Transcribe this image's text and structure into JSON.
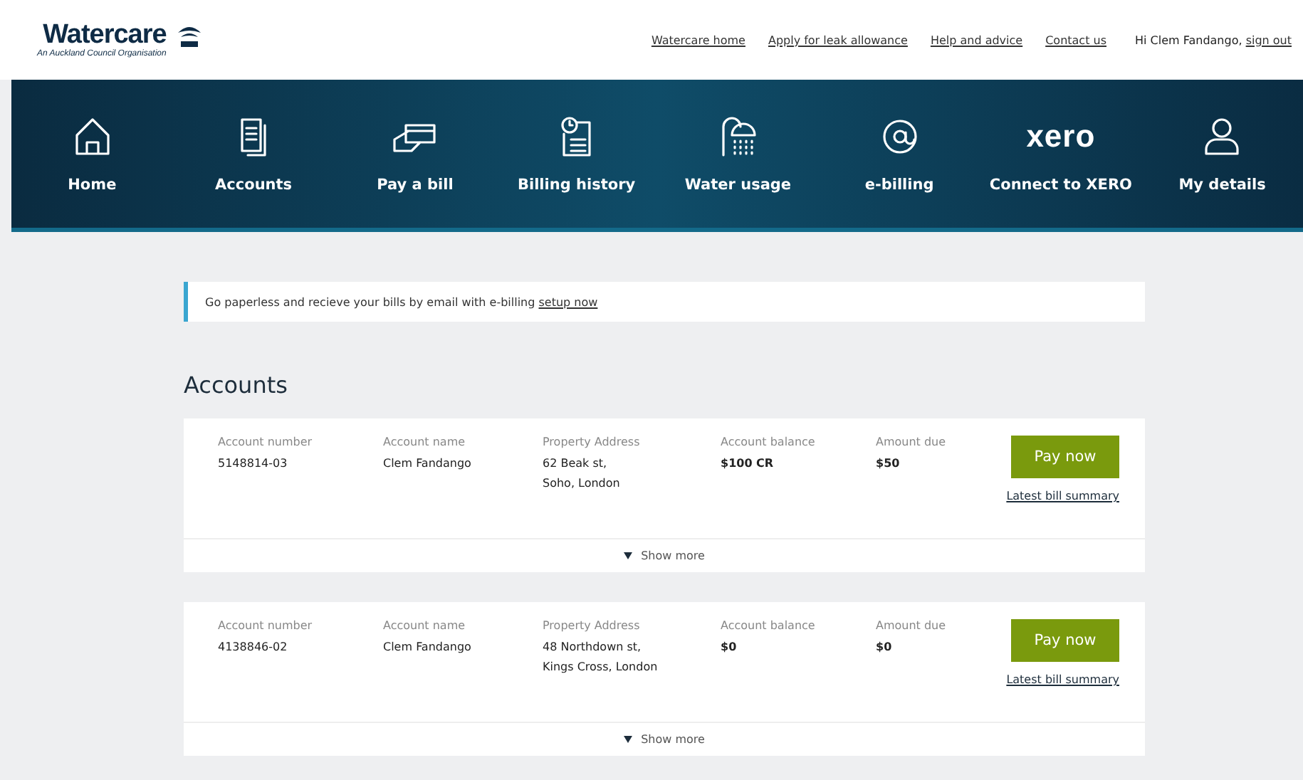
{
  "brand": {
    "name": "Watercare",
    "tagline": "An Auckland Council Organisation"
  },
  "top_links": [
    {
      "label": "Watercare home"
    },
    {
      "label": "Apply for leak allowance"
    },
    {
      "label": "Help and advice"
    },
    {
      "label": "Contact us"
    }
  ],
  "user": {
    "greeting": "Hi Clem Fandango,",
    "sign_out": "sign out"
  },
  "nav": [
    {
      "label": "Home"
    },
    {
      "label": "Accounts"
    },
    {
      "label": "Pay a bill"
    },
    {
      "label": "Billing history"
    },
    {
      "label": "Water usage"
    },
    {
      "label": "e-billing"
    },
    {
      "label": "Connect to XERO",
      "logo_text": "xero"
    },
    {
      "label": "My details"
    }
  ],
  "notice": {
    "text": "Go paperless and recieve your bills by email with e-billing",
    "link": "setup now"
  },
  "section_title": "Accounts",
  "accounts": [
    {
      "fields": [
        {
          "label": "Account number",
          "value": "5148814-03",
          "bold": false
        },
        {
          "label": "Account name",
          "value": "Clem Fandango",
          "bold": false
        },
        {
          "label": "Property Address",
          "value": "62 Beak st,\nSoho, London",
          "bold": false
        },
        {
          "label": "Account balance",
          "value": "$100 CR",
          "bold": true
        },
        {
          "label": "Amount due",
          "value": "$50",
          "bold": true
        }
      ],
      "pay": "Pay now",
      "summary": "Latest bill summary",
      "more": "Show more",
      "expanded": false
    },
    {
      "fields": [
        {
          "label": "Account number",
          "value": "4138846-02",
          "bold": false
        },
        {
          "label": "Account name",
          "value": "Clem Fandango",
          "bold": false
        },
        {
          "label": "Property Address",
          "value": "48 Northdown st,\nKings Cross, London",
          "bold": false
        },
        {
          "label": "Account balance",
          "value": "$0",
          "bold": true
        },
        {
          "label": "Amount due",
          "value": "$0",
          "bold": true
        }
      ],
      "pay": "Pay now",
      "summary": "Latest bill summary",
      "more": "Show more",
      "expanded": false
    }
  ]
}
